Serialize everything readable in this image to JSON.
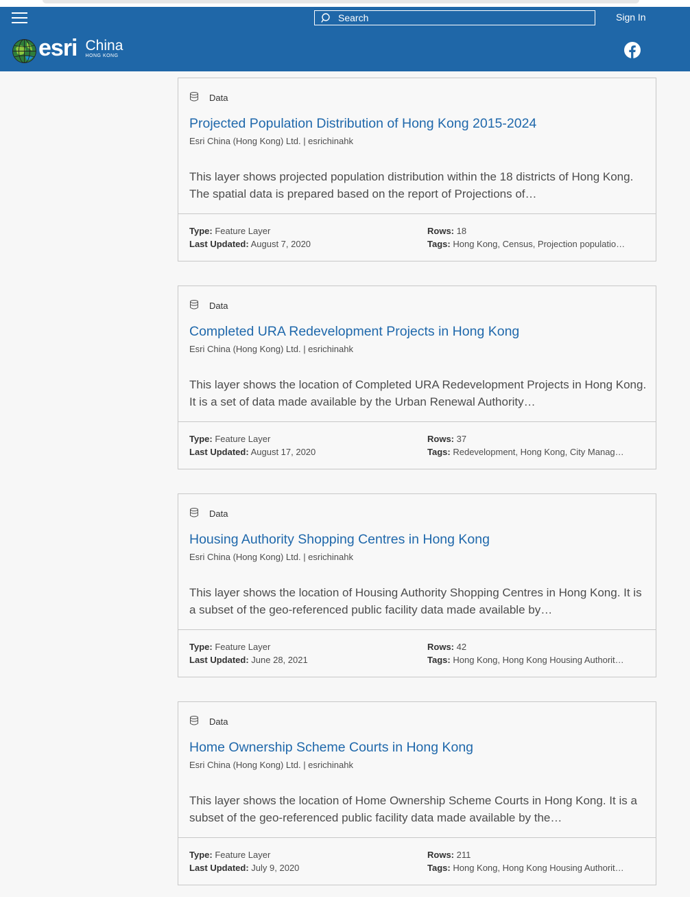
{
  "header": {
    "search_placeholder": "Search",
    "sign_in": "Sign In",
    "logo_esri": "esri",
    "logo_china": "China",
    "logo_hk": "HONG KONG",
    "colors": {
      "bar": "#1f67a8",
      "link": "#1f68ab"
    }
  },
  "labels": {
    "type": "Type:",
    "last_updated": "Last Updated:",
    "rows": "Rows:",
    "tags": "Tags:"
  },
  "cards": [
    {
      "kind": "Data",
      "title": "Projected Population Distribution of Hong Kong 2015-2024",
      "owner": "Esri China (Hong Kong) Ltd. | esrichinahk",
      "description": "This layer shows projected population distribution within the 18 districts of Hong Kong. The spatial data is prepared based on the report of Projections of…",
      "type": "Feature Layer",
      "last_updated": "August 7, 2020",
      "rows": "18",
      "tags": "Hong Kong, Census, Projection populatio…"
    },
    {
      "kind": "Data",
      "title": "Completed URA Redevelopment Projects in Hong Kong",
      "owner": "Esri China (Hong Kong) Ltd. | esrichinahk",
      "description": "This layer shows the location of Completed URA Redevelopment Projects in Hong Kong. It is a set of data made available by the Urban Renewal Authority…",
      "type": "Feature Layer",
      "last_updated": "August 17, 2020",
      "rows": "37",
      "tags": "Redevelopment, Hong Kong, City Manag…"
    },
    {
      "kind": "Data",
      "title": "Housing Authority Shopping Centres in Hong Kong",
      "owner": "Esri China (Hong Kong) Ltd. | esrichinahk",
      "description": "This layer shows the location of Housing Authority Shopping Centres in Hong Kong. It is a subset of the geo-referenced public facility data made available by…",
      "type": "Feature Layer",
      "last_updated": "June 28, 2021",
      "rows": "42",
      "tags": "Hong Kong, Hong Kong Housing Authorit…"
    },
    {
      "kind": "Data",
      "title": "Home Ownership Scheme Courts in Hong Kong",
      "owner": "Esri China (Hong Kong) Ltd. | esrichinahk",
      "description": "This layer shows the location of Home Ownership Scheme Courts in Hong Kong. It is a subset of the geo-referenced public facility data made available by the…",
      "type": "Feature Layer",
      "last_updated": "July 9, 2020",
      "rows": "211",
      "tags": "Hong Kong, Hong Kong Housing Authorit…"
    }
  ]
}
